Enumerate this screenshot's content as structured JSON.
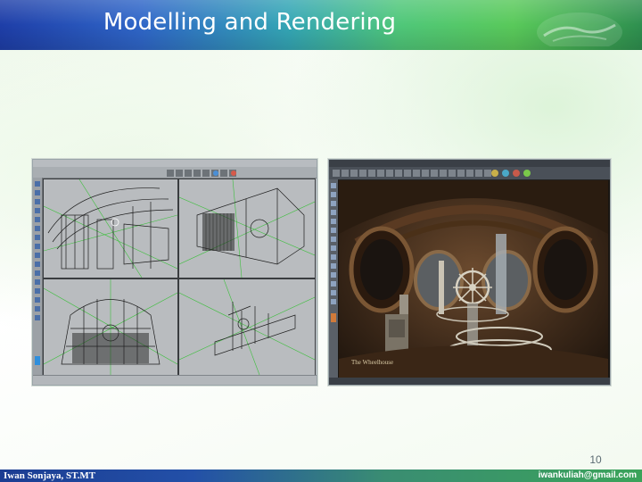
{
  "slide": {
    "title": "Modelling and Rendering",
    "page_number": "10"
  },
  "footer": {
    "author": "Iwan Sonjaya, ST.MT",
    "email": "iwankuliah@gmail.com"
  },
  "images": {
    "left": {
      "icon": "wireframe-modelling-screenshot"
    },
    "right": {
      "icon": "rendered-scene-screenshot",
      "caption": "The Wheelhouse"
    }
  },
  "colors": {
    "title_bar_start": "#1e3ea8",
    "title_bar_end": "#2e8f4f",
    "footer_start": "#1b3d92",
    "footer_end": "#3aa35a",
    "wire_green": "#3dbf3d"
  }
}
